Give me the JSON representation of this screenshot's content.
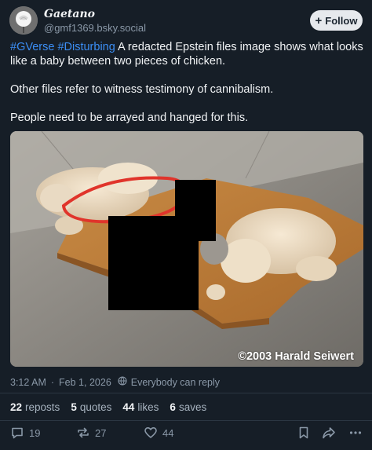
{
  "author": {
    "display_name": "Gaetano",
    "handle": "@gmf1369.bsky.social",
    "avatar_icon": "white-rose-avatar"
  },
  "follow_button": {
    "label": "Follow",
    "icon": "plus-icon"
  },
  "post": {
    "hashtags": [
      "#GVerse",
      "#Disturbing"
    ],
    "line1": "A redacted Epstein files image shows what looks like a baby between two pieces of chicken.",
    "line2": "Other files refer to witness testimony of cannibalism.",
    "line3": "People need to be arrayed and hanged for this."
  },
  "media": {
    "watermark": "©2003 Harald Seiwert",
    "annotation_color": "#e0342b",
    "redaction_color": "#000000"
  },
  "meta": {
    "time": "3:12 AM",
    "date": "Feb 1, 2026",
    "separator": "·",
    "reply_setting": "Everybody can reply"
  },
  "stats": {
    "reposts": {
      "count": "22",
      "label": "reposts"
    },
    "quotes": {
      "count": "5",
      "label": "quotes"
    },
    "likes": {
      "count": "44",
      "label": "likes"
    },
    "saves": {
      "count": "6",
      "label": "saves"
    }
  },
  "actions": {
    "reply_count": "19",
    "repost_count": "27",
    "like_count": "44"
  },
  "colors": {
    "background": "#161e27",
    "link": "#3b8ef5",
    "muted": "#8a98a7"
  }
}
